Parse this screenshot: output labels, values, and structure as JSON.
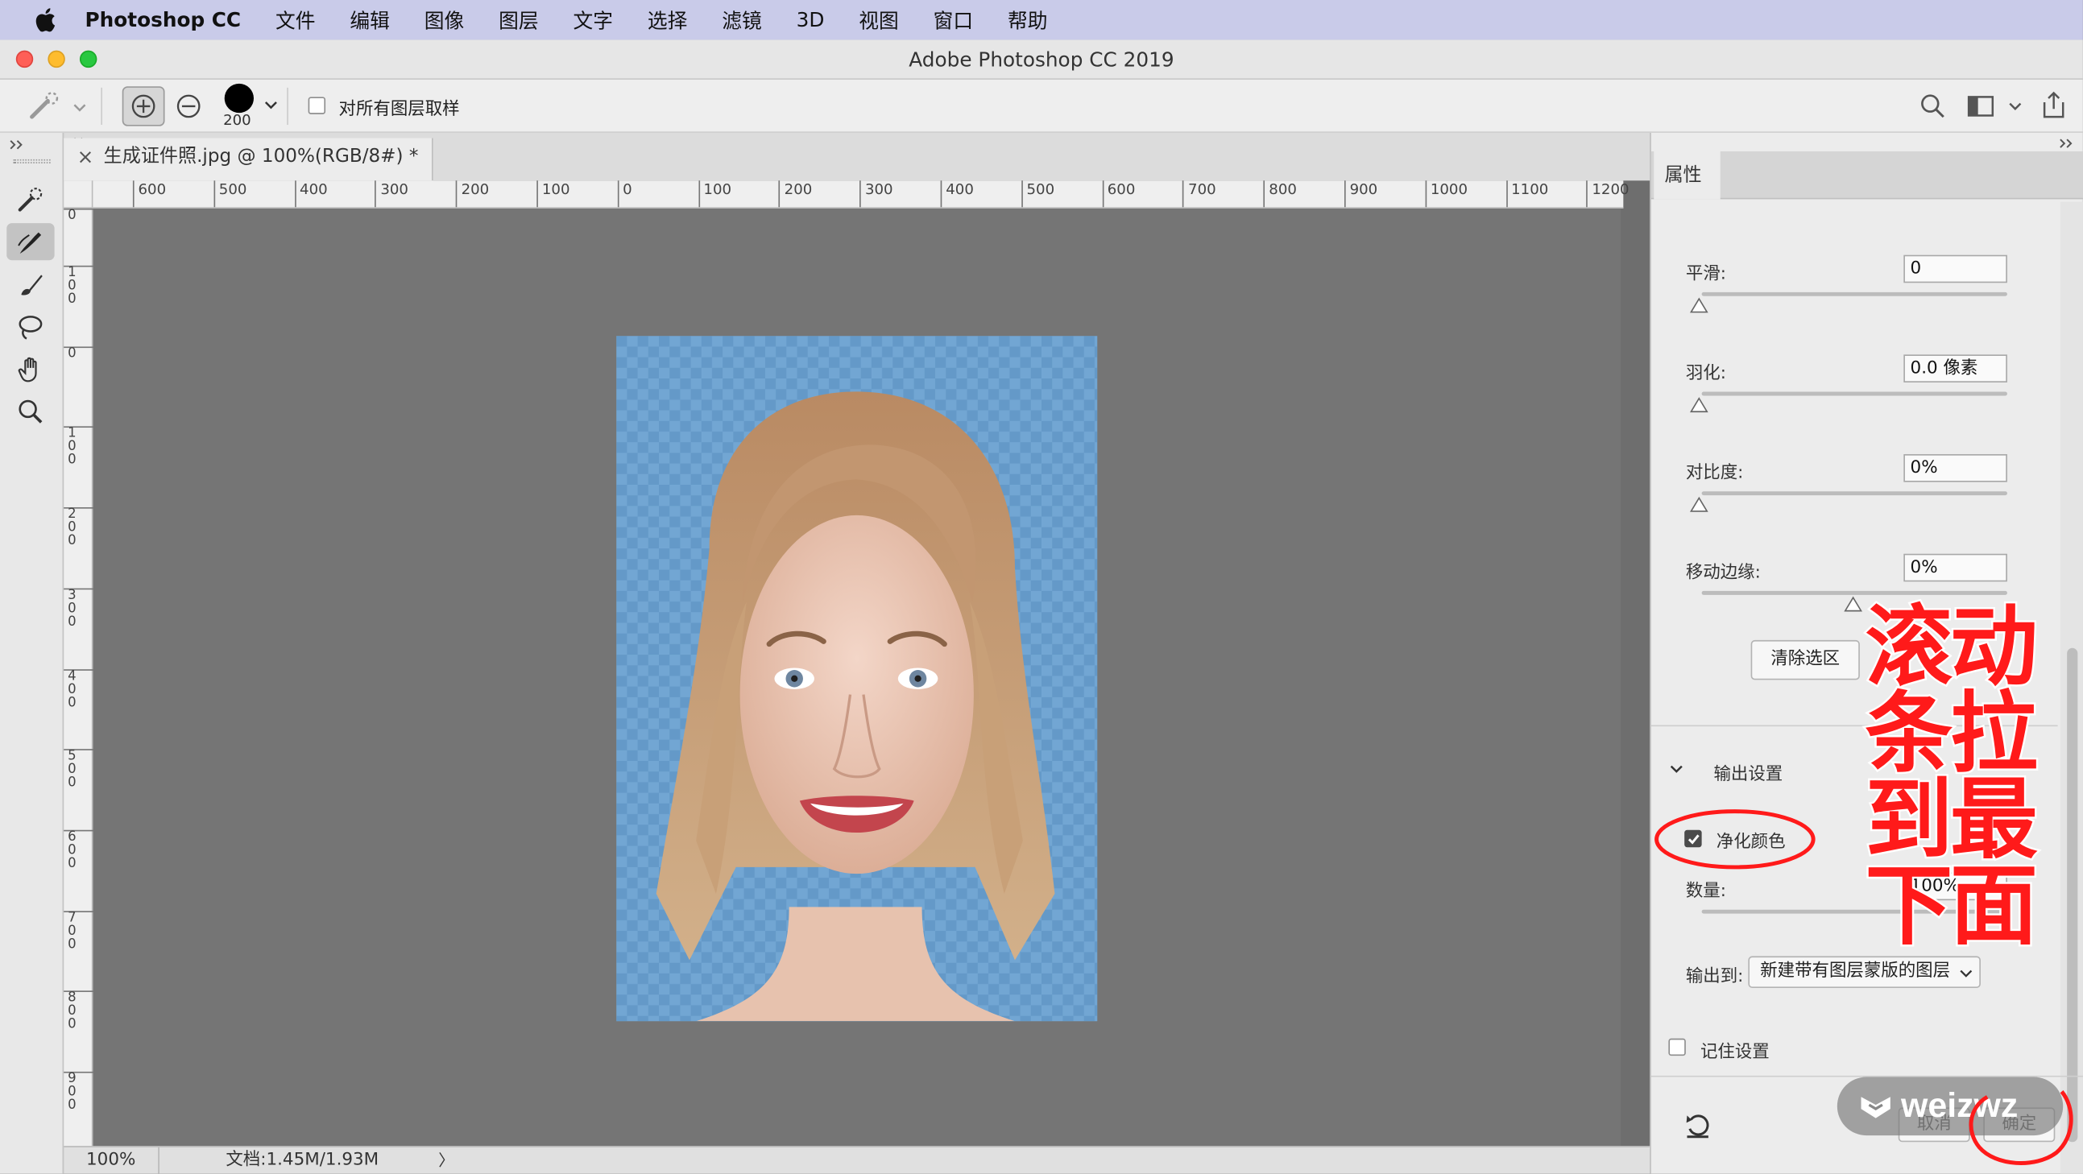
{
  "menubar": {
    "app_name": "Photoshop CC",
    "items": [
      "文件",
      "编辑",
      "图像",
      "图层",
      "文字",
      "选择",
      "滤镜",
      "3D",
      "视图",
      "窗口",
      "帮助"
    ]
  },
  "window": {
    "title": "Adobe Photoshop CC 2019"
  },
  "options_bar": {
    "brush_size": "200",
    "sample_all_layers_label": "对所有图层取样",
    "sample_all_layers_checked": false
  },
  "document": {
    "tab_title": "生成证件照.jpg @ 100%(RGB/8#) *",
    "close_glyph": "×"
  },
  "rulers": {
    "horizontal": [
      "600",
      "500",
      "400",
      "300",
      "200",
      "100",
      "0",
      "100",
      "200",
      "300",
      "400",
      "500",
      "600",
      "700",
      "800",
      "900",
      "1000",
      "1100",
      "1200"
    ],
    "vertical": [
      "0",
      "1\n0\n0",
      "0",
      "1\n0\n0",
      "2\n0\n0",
      "3\n0\n0",
      "4\n0\n0",
      "5\n0\n0",
      "6\n0\n0",
      "7\n0\n0",
      "8\n0\n0",
      "9\n0\n0"
    ]
  },
  "status_bar": {
    "zoom": "100%",
    "doc_info": "文档:1.45M/1.93M",
    "arrow": "〉"
  },
  "properties_panel": {
    "tab": "属性",
    "smooth": {
      "label": "平滑:",
      "value": "0"
    },
    "feather": {
      "label": "羽化:",
      "value": "0.0 像素"
    },
    "contrast": {
      "label": "对比度:",
      "value": "0%"
    },
    "shift_edge": {
      "label": "移动边缘:",
      "value": "0%"
    },
    "clear_selection_button": "清除选区",
    "output_settings": {
      "header": "输出设置",
      "decontaminate_label": "净化颜色",
      "decontaminate_checked": true,
      "amount_label": "数量:",
      "amount_value": "100%",
      "output_to_label": "输出到:",
      "output_to_value": "新建带有图层蒙版的图层",
      "remember_label": "记住设置",
      "remember_checked": false
    },
    "cancel_button": "取消",
    "ok_button": "确定"
  },
  "annotation": {
    "text_line1": "滚动",
    "text_line2": "条拉",
    "text_line3": "到最",
    "text_line4": "下面",
    "color": "#ff1a1a"
  },
  "watermark": {
    "text": "weizwz"
  }
}
